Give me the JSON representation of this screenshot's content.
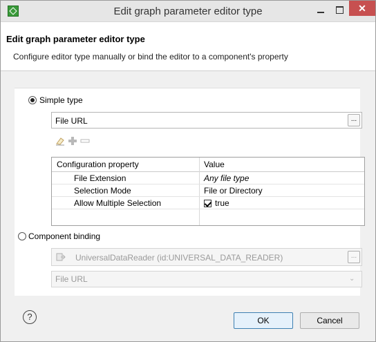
{
  "window": {
    "title": "Edit graph parameter editor type",
    "close_glyph": "✕"
  },
  "header": {
    "title": "Edit graph parameter editor type",
    "description": "Configure editor type manually or bind the editor to a component's property"
  },
  "simple_type": {
    "label": "Simple type",
    "checked": true,
    "type_value": "File URL",
    "browse_label": "..."
  },
  "config_table": {
    "columns": [
      "Configuration property",
      "Value"
    ],
    "rows": [
      {
        "property": "File Extension",
        "value": "Any file type"
      },
      {
        "property": "Selection Mode",
        "value": "File or Directory"
      },
      {
        "property": "Allow Multiple Selection",
        "value": "true",
        "checked": true
      }
    ]
  },
  "component_binding": {
    "label": "Component binding",
    "checked": false,
    "component_value": "UniversalDataReader (id:UNIVERSAL_DATA_READER)",
    "browse_label": "...",
    "property_value": "File URL"
  },
  "footer": {
    "help_glyph": "?",
    "ok_label": "OK",
    "cancel_label": "Cancel"
  }
}
